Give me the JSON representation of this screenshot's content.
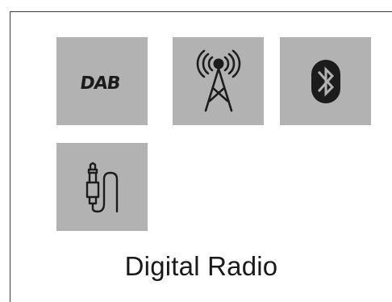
{
  "colors": {
    "tile_background": "#b2b2b2",
    "icon": "#1c1c1c",
    "screen_border": "#3a3a3a",
    "background": "#ffffff"
  },
  "sources": [
    {
      "id": "dab",
      "icon": "dab-logo-icon",
      "label": "DAB"
    },
    {
      "id": "fm",
      "icon": "radio-tower-icon"
    },
    {
      "id": "bluetooth",
      "icon": "bluetooth-icon"
    },
    {
      "id": "aux",
      "icon": "audio-jack-icon"
    }
  ],
  "current_source": "Digital Radio"
}
